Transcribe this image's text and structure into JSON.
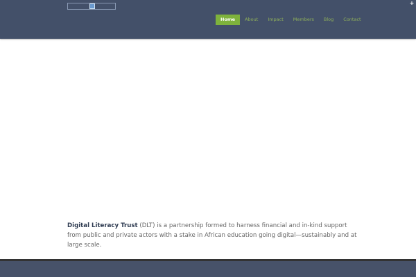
{
  "header": {
    "logo_icon": "image-placeholder-icon",
    "nav": [
      {
        "label": "Home",
        "active": true
      },
      {
        "label": "About"
      },
      {
        "label": "Impact"
      },
      {
        "label": "Members"
      },
      {
        "label": "Blog"
      },
      {
        "label": "Contact"
      }
    ],
    "corner_label": "+"
  },
  "intro": {
    "org_name": "Digital Literacy Trust",
    "text": " (DLT) is a partnership formed to harness financial and in-kind support from public and private actors with a stake in African education going digital—sustainably and at large scale."
  },
  "colors": {
    "header": "#435069",
    "accent": "#7eb23c",
    "footer": "#475269"
  }
}
